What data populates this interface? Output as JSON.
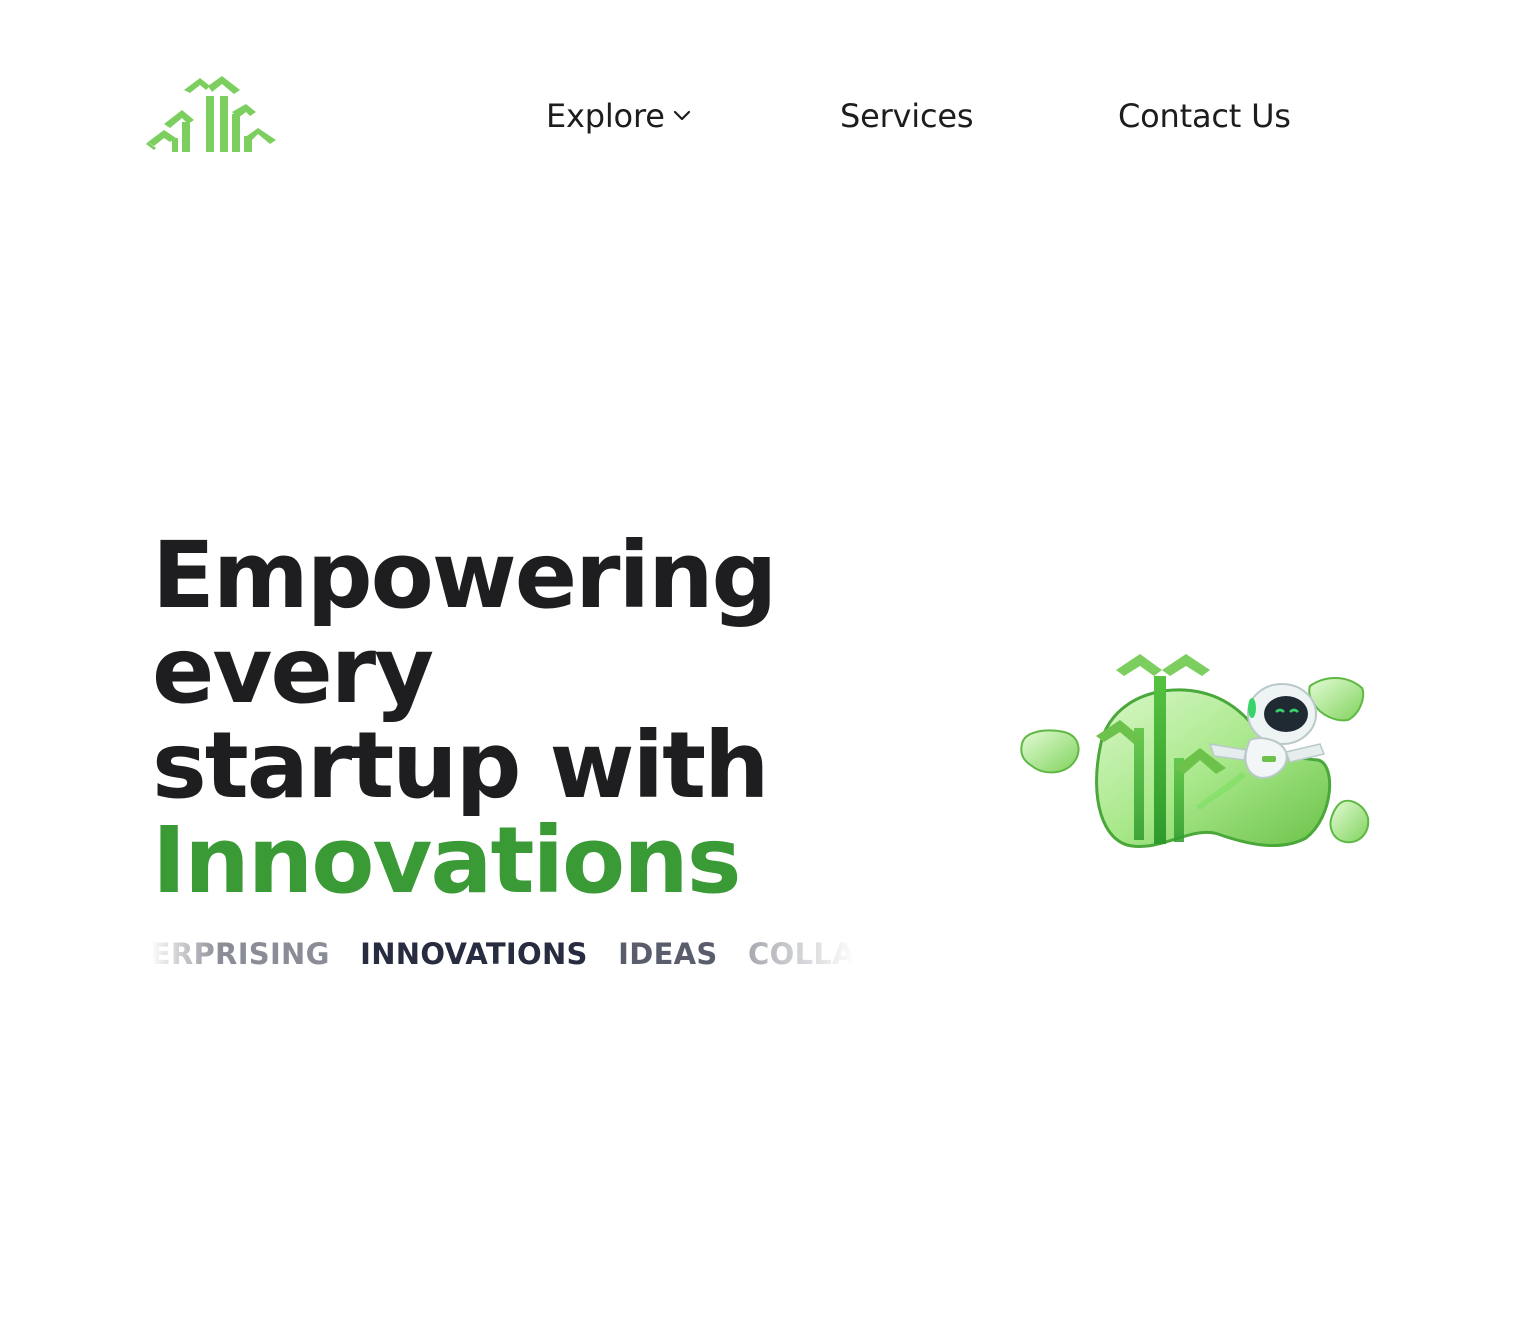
{
  "header": {
    "logo_icon": "sprout-arrows-logo",
    "nav": {
      "explore_label": "Explore",
      "explore_icon": "chevron-down-icon",
      "services_label": "Services",
      "contact_label": "Contact Us"
    }
  },
  "hero": {
    "title_lines": [
      "Empowering",
      "every",
      "startup with"
    ],
    "title_accent": "Innovations",
    "ticker_words": [
      "ENTERPRISING",
      "INNOVATIONS",
      "IDEAS",
      "COLLAB"
    ]
  },
  "illustration": {
    "name": "robot-sprout-illustration"
  },
  "colors": {
    "accent_green": "#3a9a35",
    "logo_green": "#7ccf5f",
    "text_dark": "#1e1e20",
    "ticker_dark": "#282c40"
  }
}
